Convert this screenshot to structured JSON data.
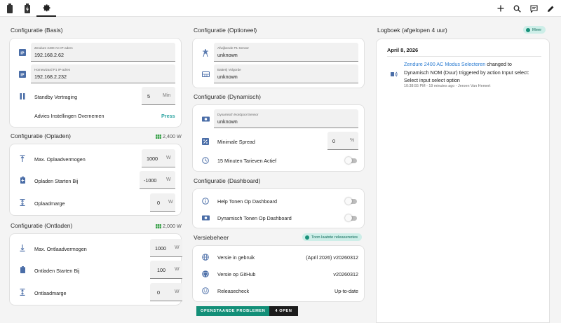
{
  "toolbar": {
    "tabs": [
      {
        "icon": "battery-icon"
      },
      {
        "icon": "battery-charging-icon"
      },
      {
        "icon": "gear-icon"
      }
    ],
    "actions": [
      "plus-icon",
      "search-icon",
      "comment-icon",
      "pencil-icon"
    ]
  },
  "basis": {
    "title": "Configuratie (Basis)",
    "ip1": {
      "label": "Zendure 2400 AC IP-adres",
      "value": "192.168.2.62"
    },
    "ip2": {
      "label": "Homewizard P1 IP-adres",
      "value": "192.168.2.232"
    },
    "standby": {
      "label": "Standby Vertraging",
      "value": "5",
      "unit": "Min"
    },
    "advies": {
      "label": "Advies Instellingen Overnemen",
      "action": "Press"
    }
  },
  "opladen": {
    "title": "Configuratie (Opladen)",
    "power": "2,400 W",
    "rows": [
      {
        "label": "Max. Oplaadvermogen",
        "value": "1000",
        "unit": "W"
      },
      {
        "label": "Opladen Starten Bij",
        "value": "-1000",
        "unit": "W"
      },
      {
        "label": "Oplaadmarge",
        "value": "0",
        "unit": "W"
      }
    ]
  },
  "ontladen": {
    "title": "Configuratie (Ontladen)",
    "power": "2,000 W",
    "rows": [
      {
        "label": "Max. Ontlaadvermogen",
        "value": "1000",
        "unit": "W"
      },
      {
        "label": "Ontladen Starten Bij",
        "value": "100",
        "unit": "W"
      },
      {
        "label": "Ontlaadmarge",
        "value": "0",
        "unit": "W"
      }
    ]
  },
  "optioneel": {
    "title": "Configuratie (Optioneel)",
    "fields": [
      {
        "label": "Afwijkende P1 Sensor",
        "value": "unknown"
      },
      {
        "label": "Batterij Volgorde",
        "value": "unknown"
      }
    ]
  },
  "dynamisch": {
    "title": "Configuratie (Dynamisch)",
    "sensor": {
      "label": "Dynamisch Nordpool Sensor",
      "value": "unknown"
    },
    "spread": {
      "label": "Minimale Spread",
      "value": "0",
      "unit": "%"
    },
    "tarieven": {
      "label": "15 Minuten Tarieven Actief",
      "on": false
    }
  },
  "dashboard": {
    "title": "Configuratie (Dashboard)",
    "rows": [
      {
        "label": "Help Tonen Op Dashboard",
        "on": false
      },
      {
        "label": "Dynamisch Tonen Op Dashboard",
        "on": false
      }
    ]
  },
  "versie": {
    "title": "Versiebeheer",
    "pill": "Toon laatste releasenotes",
    "rows": [
      {
        "label": "Versie in gebruik",
        "value": "(April 2026) v20260312"
      },
      {
        "label": "Versie op GitHub",
        "value": "v20260312"
      },
      {
        "label": "Releasecheck",
        "value": "Up-to-date"
      }
    ]
  },
  "issues": {
    "label": "OPENSTAANDE PROBLEMEN",
    "count": "4 OPEN"
  },
  "logboek": {
    "title": "Logboek (afgelopen 4 uur)",
    "more": "Meer",
    "date": "April 8, 2026",
    "entry": {
      "entity": "Zendure 2400 AC Modus Selecteren",
      "text": " changed to Dynamisch NOM (Duur) triggered by action Input select: Select input select option",
      "meta": "10:38:55 PM - 19 minutes ago - Jeroen Van Hemert"
    }
  },
  "colors": {
    "accent": "#03a9f4",
    "teal": "#19917a",
    "press": "#2ba3a0",
    "link": "#2a7bd1",
    "icon": "#4a6da7"
  }
}
